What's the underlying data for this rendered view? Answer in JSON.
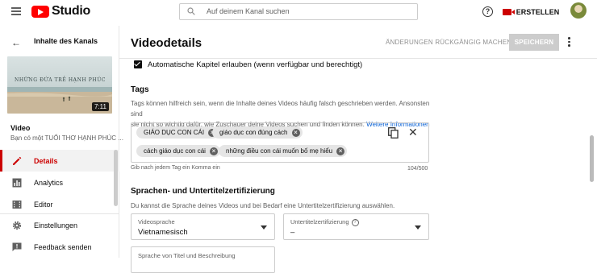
{
  "header": {
    "logo_text": "Studio",
    "search_placeholder": "Auf deinem Kanal suchen",
    "help_glyph": "?",
    "create_label": "ERSTELLEN"
  },
  "sidebar": {
    "back_title": "Inhalte des Kanals",
    "thumbnail": {
      "overlay_text": "NHỮNG ĐỨA TRẺ HẠNH PHÚC",
      "duration": "7:11"
    },
    "video_label": "Video",
    "video_subtitle": "Bạn có một TUỔI THƠ HẠNH PHÚC ...",
    "items": [
      {
        "label": "Details",
        "icon": "pencil-icon",
        "active": true
      },
      {
        "label": "Analytics",
        "icon": "bar-chart-icon",
        "active": false
      },
      {
        "label": "Editor",
        "icon": "film-icon",
        "active": false
      },
      {
        "label": "Einstellungen",
        "icon": "gear-icon",
        "active": false
      },
      {
        "label": "Feedback senden",
        "icon": "feedback-icon",
        "active": false
      }
    ]
  },
  "main": {
    "title": "Videodetails",
    "undo_label": "ÄNDERUNGEN RÜCKGÄNGIG MACHEN",
    "save_label": "SPEICHERN",
    "chapters_checkbox_label": "Automatische Kapitel erlauben (wenn verfügbar und berechtigt)",
    "tags": {
      "title": "Tags",
      "description_line1": "Tags können hilfreich sein, wenn die Inhalte deines Videos häufig falsch geschrieben werden. Ansonsten sind",
      "description_line2": "sie nicht so wichtig dafür, wie Zuschauer deine Videos suchen und finden können.",
      "learn_more": "Weitere Informationen",
      "chips": [
        "GIÁO DỤC CON CÁI",
        "giáo dục con đúng cách",
        "cách giáo dục con cái",
        "những điều con cái muốn bố mẹ hiểu"
      ],
      "hint": "Gib nach jedem Tag ein Komma ein",
      "counter": "104/500"
    },
    "language": {
      "title": "Sprachen- und Untertitelzertifizierung",
      "description": "Du kannst die Sprache deines Videos und bei Bedarf eine Untertitelzertifizierung auswählen.",
      "video_language_label": "Videosprache",
      "video_language_value": "Vietnamesisch",
      "caption_cert_label": "Untertitelzertifizierung",
      "caption_cert_value": "–",
      "title_desc_language_label": "Sprache von Titel und Beschreibung"
    }
  },
  "colors": {
    "brand_red": "#ff0000",
    "active_red": "#cc0000",
    "link_blue": "#065fd4",
    "save_disabled": "#cccccc"
  }
}
